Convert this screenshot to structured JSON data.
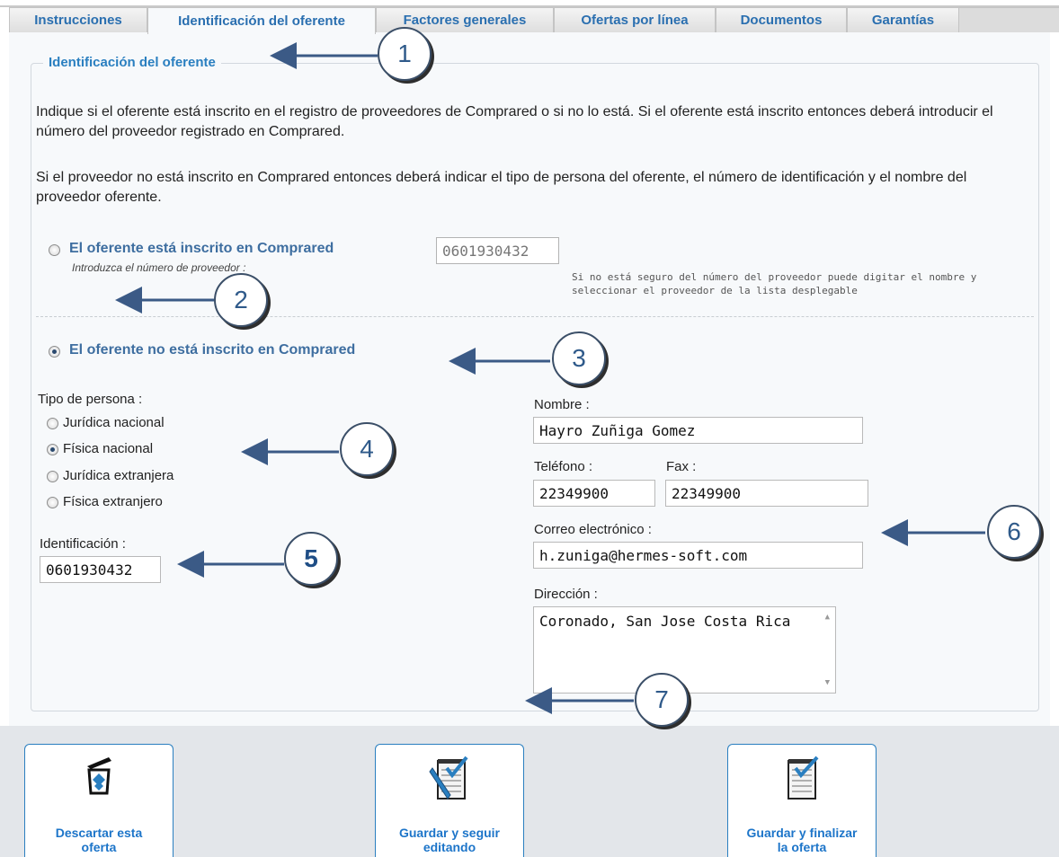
{
  "tabs": [
    {
      "label": "Instrucciones"
    },
    {
      "label": "Identificación del oferente"
    },
    {
      "label": "Factores generales"
    },
    {
      "label": "Ofertas por línea"
    },
    {
      "label": "Documentos"
    },
    {
      "label": "Garantías"
    }
  ],
  "section": {
    "legend": "Identificación del oferente",
    "intro_1": "Indique si el oferente está inscrito en el registro de proveedores de Comprared o si no lo está. Si el oferente está inscrito entonces deberá introducir el número del proveedor registrado en Comprared.",
    "intro_2": "Si el proveedor no está inscrito en Comprared entonces deberá indicar el tipo de persona del oferente, el número de identificación y el nombre del proveedor oferente."
  },
  "registered": {
    "title": "El oferente está inscrito en Comprared",
    "hint": "Introduzca el número de proveedor :",
    "value": "0601930432",
    "help_line_1": "Si no está seguro del número del proveedor puede digitar el nombre y",
    "help_line_2": "seleccionar el proveedor de la lista desplegable"
  },
  "not_registered": {
    "title": "El oferente no está inscrito en Comprared"
  },
  "person_type": {
    "label": "Tipo de persona :",
    "options": [
      "Jurídica nacional",
      "Física nacional",
      "Jurídica extranjera",
      "Física extranjero"
    ],
    "selected": "Física nacional"
  },
  "identification": {
    "label": "Identificación :",
    "value": "0601930432"
  },
  "nombre": {
    "label": "Nombre :",
    "value": "Hayro Zuñiga Gomez"
  },
  "telefono": {
    "label": "Teléfono :",
    "value": "22349900"
  },
  "fax": {
    "label": "Fax :",
    "value": "22349900"
  },
  "correo": {
    "label": "Correo electrónico :",
    "value": "h.zuniga@hermes-soft.com"
  },
  "direccion": {
    "label": "Dirección :",
    "value": "Coronado, San Jose Costa Rica"
  },
  "actions": {
    "discard": {
      "line1": "Descartar esta",
      "line2": "oferta"
    },
    "save_continue": {
      "line1": "Guardar y seguir",
      "line2": "editando"
    },
    "save_finish": {
      "line1": "Guardar y finalizar",
      "line2": "la oferta"
    }
  },
  "callouts": [
    "1",
    "2",
    "3",
    "4",
    "5",
    "6",
    "7"
  ],
  "colors": {
    "accent": "#2a7fc0",
    "link_blue": "#1d75c9",
    "callout_border": "#3b4f68"
  }
}
